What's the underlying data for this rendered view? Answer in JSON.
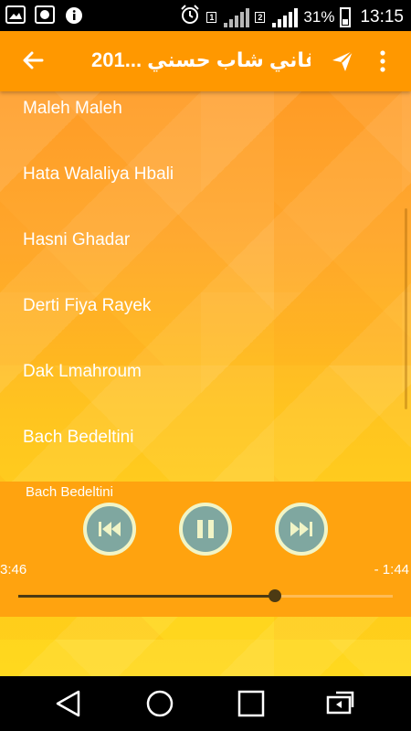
{
  "status_bar": {
    "battery_text": "31%",
    "time": "13:15",
    "sim1": "1",
    "sim2": "2",
    "icons": [
      "gallery-icon",
      "chat-icon",
      "info-icon",
      "alarm-icon",
      "signal-icon",
      "battery-icon"
    ]
  },
  "app_bar": {
    "title": "أغاني شاب حسني ...201",
    "back_icon": "arrow-back-icon",
    "share_icon": "send-icon",
    "more_icon": "more-vert-icon"
  },
  "songs": [
    "Maleh Maleh",
    "Hata Walaliya Hbali",
    "Hasni Ghadar",
    "Derti Fiya Rayek",
    "Dak Lmahroum",
    "Bach Bedeltini"
  ],
  "player": {
    "now_playing": "Bach Bedeltini",
    "elapsed": "3:46",
    "remaining": "- 1:44",
    "progress": 0.685,
    "controls": [
      "previous-icon",
      "pause-icon",
      "next-icon"
    ]
  },
  "nav_bar": {
    "icons": [
      "back-triangle-icon",
      "home-circle-icon",
      "recents-square-icon",
      "screen-rotate-icon"
    ]
  },
  "colors": {
    "app_bar": "#ff9800",
    "player_bg": "#ffa30f",
    "button_fill": "#7fa7a0",
    "seek_fill": "#4c3a13"
  }
}
